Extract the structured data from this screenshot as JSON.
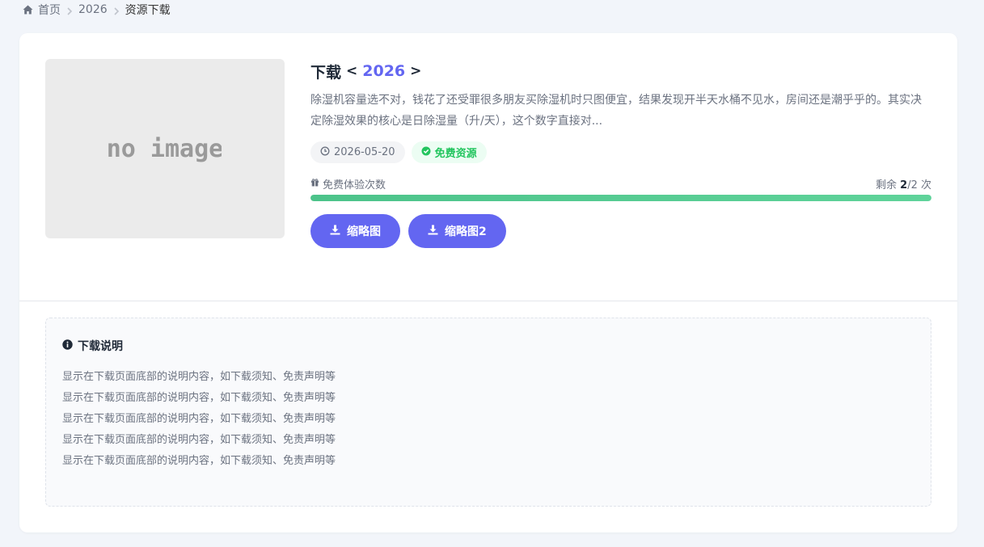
{
  "breadcrumb": {
    "home": "首页",
    "category": "2026",
    "current": "资源下载"
  },
  "thumbnail": {
    "text": "no image"
  },
  "resource": {
    "title_prefix": "下载",
    "bracket_open": "<",
    "year": "2026",
    "bracket_close": ">",
    "description": "除湿机容量选不对，钱花了还受罪很多朋友买除湿机时只图便宜，结果发现开半天水桶不见水，房间还是潮乎乎的。其实决定除湿效果的核心是日除湿量（升/天），这个数字直接对...",
    "date": "2026-05-20",
    "badge": "免费资源"
  },
  "quota": {
    "label": "免费体验次数",
    "prefix": "剩余",
    "remaining": "2",
    "total": "/2 次",
    "fill_fraction": 1.0
  },
  "buttons": [
    {
      "label": "缩略图"
    },
    {
      "label": "缩略图2"
    }
  ],
  "notice": {
    "title": "下载说明",
    "lines": [
      "显示在下载页面底部的说明内容，如下载须知、免责声明等",
      "显示在下载页面底部的说明内容，如下载须知、免责声明等",
      "显示在下载页面底部的说明内容，如下载须知、免责声明等",
      "显示在下载页面底部的说明内容，如下载须知、免责声明等",
      "显示在下载页面底部的说明内容，如下载须知、免责声明等"
    ]
  },
  "colors": {
    "accent": "#6366f1",
    "success": "#22c55e",
    "progress": "#4cc38a"
  },
  "icons": {
    "home": "home-icon",
    "separator": "chevron-right-icon",
    "clock": "clock-icon",
    "check": "check-circle-icon",
    "gift": "gift-icon",
    "download": "download-icon",
    "info": "info-circle-icon"
  }
}
